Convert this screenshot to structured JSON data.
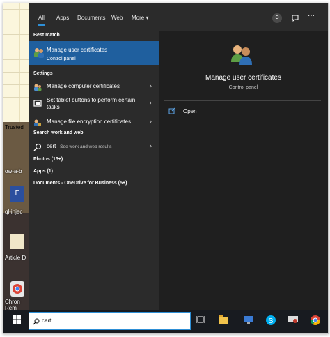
{
  "tabs": [
    "All",
    "Apps",
    "Documents",
    "Web",
    "More ▾"
  ],
  "header_buttons": {
    "avatar_letter": "C"
  },
  "best_match": {
    "section_title": "Best match",
    "title": "Manage user certificates",
    "subtitle": "Control panel"
  },
  "settings": {
    "section_title": "Settings",
    "items": [
      {
        "label": "Manage computer certificates"
      },
      {
        "label": "Set tablet buttons to perform certain tasks"
      },
      {
        "label": "Manage file encryption certificates"
      }
    ]
  },
  "search_web": {
    "section_title": "Search work and web",
    "query": "cert",
    "suffix": " - See work and web results"
  },
  "categories": [
    {
      "label": "Photos (15+)"
    },
    {
      "label": "Apps (1)"
    },
    {
      "label": "Documents - OneDrive for Business (5+)"
    }
  ],
  "preview": {
    "title": "Manage user certificates",
    "subtitle": "Control panel",
    "actions": [
      {
        "label": "Open"
      }
    ]
  },
  "search_box": {
    "value": "cert"
  },
  "desktop_labels": [
    "Trusted",
    "ow-a-b",
    "ql-injec",
    "Article D",
    "Chron",
    "Rem"
  ],
  "colors": {
    "accent": "#2e8fd6",
    "highlight": "#1f5f9e",
    "panel": "#2b2b2b",
    "preview_panel": "#1f1f1f",
    "taskbar": "#181b20"
  },
  "icons": [
    "users-certificate-icon",
    "certificate-icon",
    "tablet-icon",
    "encryption-icon",
    "search-icon",
    "open-icon",
    "windows-start-icon",
    "task-view-icon",
    "file-explorer-icon",
    "skype-icon",
    "chrome-icon"
  ]
}
